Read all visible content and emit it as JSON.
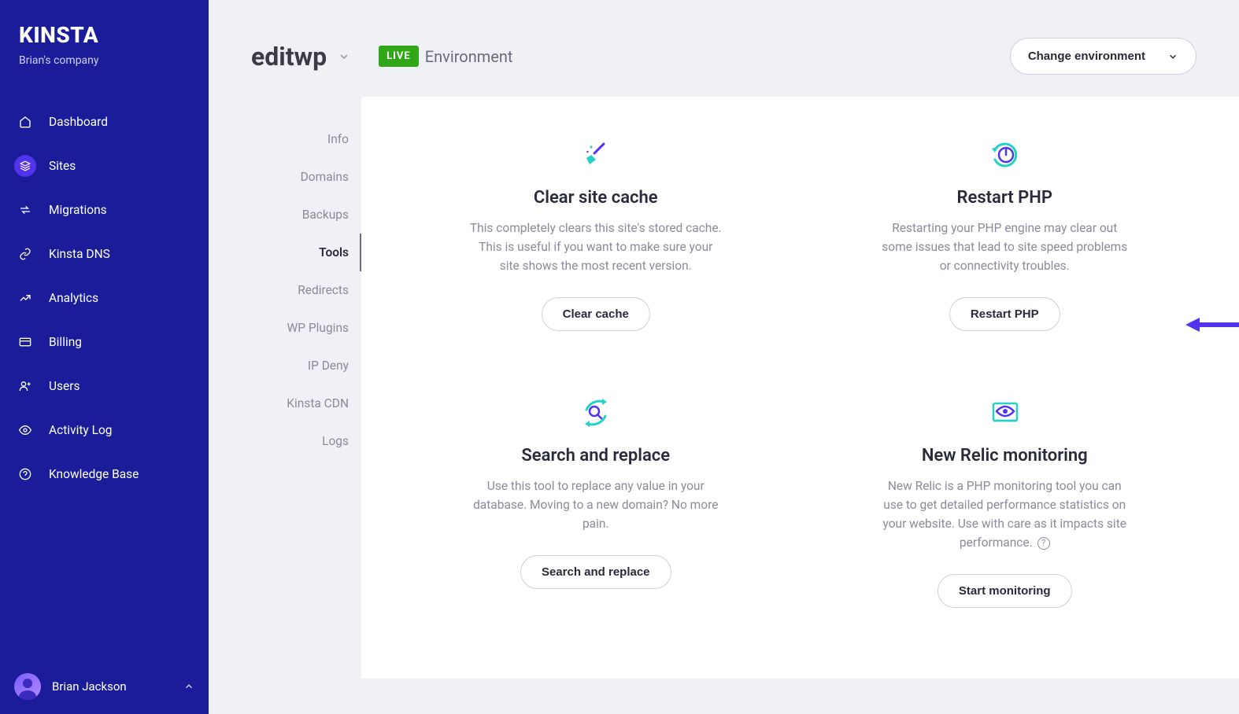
{
  "brand": "KINSTA",
  "company": "Brian's company",
  "nav": {
    "dashboard": "Dashboard",
    "sites": "Sites",
    "migrations": "Migrations",
    "dns": "Kinsta DNS",
    "analytics": "Analytics",
    "billing": "Billing",
    "users": "Users",
    "activity": "Activity Log",
    "kb": "Knowledge Base"
  },
  "user": {
    "name": "Brian Jackson"
  },
  "header": {
    "site": "editwp",
    "live_badge": "LIVE",
    "environment_label": "Environment",
    "change_env": "Change environment"
  },
  "subnav": {
    "info": "Info",
    "domains": "Domains",
    "backups": "Backups",
    "tools": "Tools",
    "redirects": "Redirects",
    "wpplugins": "WP Plugins",
    "ipdeny": "IP Deny",
    "cdn": "Kinsta CDN",
    "logs": "Logs"
  },
  "cards": {
    "clear_cache": {
      "title": "Clear site cache",
      "desc": "This completely clears this site's stored cache. This is useful if you want to make sure your site shows the most recent version.",
      "button": "Clear cache"
    },
    "restart_php": {
      "title": "Restart PHP",
      "desc": "Restarting your PHP engine may clear out some issues that lead to site speed problems or connectivity troubles.",
      "button": "Restart PHP"
    },
    "search_replace": {
      "title": "Search and replace",
      "desc": "Use this tool to replace any value in your database. Moving to a new domain? No more pain.",
      "button": "Search and replace"
    },
    "new_relic": {
      "title": "New Relic monitoring",
      "desc": "New Relic is a PHP monitoring tool you can use to get detailed performance statistics on your website. Use with care as it impacts site performance.",
      "button": "Start monitoring"
    }
  },
  "colors": {
    "accent_purple": "#5333ed",
    "teal": "#22d3c5",
    "green": "#2fa717"
  }
}
